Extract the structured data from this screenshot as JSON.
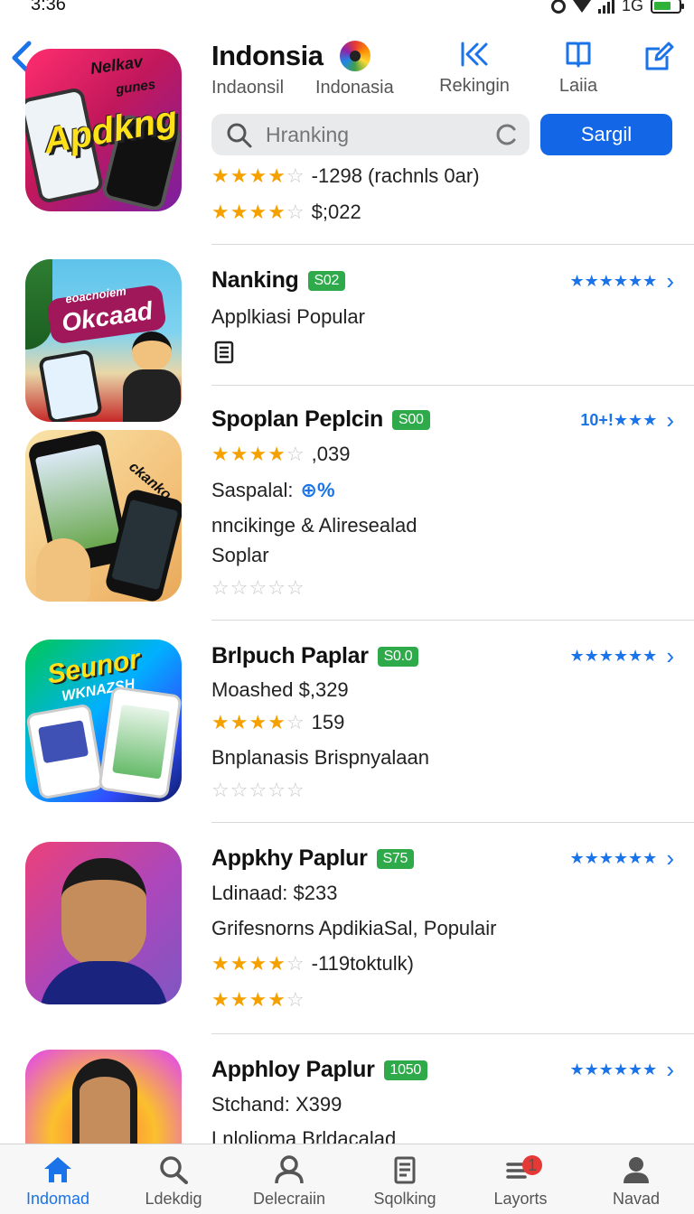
{
  "status_bar": {
    "time": "3:36",
    "network": "1G"
  },
  "header": {
    "title": "Indonsia",
    "subtitle": "Indaonsil",
    "link": "Indonasia",
    "actions": [
      {
        "label": "Rekingin",
        "icon": "rewind-icon"
      },
      {
        "label": "Laiia",
        "icon": "book-icon"
      }
    ],
    "edit_icon": "edit-icon"
  },
  "search": {
    "value": "",
    "placeholder": "Hranking",
    "button_label": "Sargil"
  },
  "featured": {
    "banner_text_top": "Nelkav",
    "banner_text_mid": "gunes",
    "banner_text_main": "Apdkng",
    "rating_line_1": {
      "stars": 4,
      "text": "-1298 (rachnls 0ar)"
    },
    "rating_line_2": {
      "stars": 4,
      "text": "$;022"
    }
  },
  "apps": [
    {
      "name": "Nanking",
      "badge": "S02",
      "rank": "★★★★★★",
      "thumb_text_top": "eoacnoiem",
      "thumb_text_main": "Okcaad",
      "lines": [
        {
          "text": "Applkiasi Popular"
        }
      ],
      "icon": "document-icon"
    },
    {
      "name": "Spoplan Peplcin",
      "badge": "S00",
      "rank": "10+!★★★",
      "thumb_text_main": "ckanko",
      "rating": {
        "stars": 4,
        "text": ",039"
      },
      "lines": [
        {
          "text": "Saspalal:",
          "extra": "⊕%"
        },
        {
          "text": "nncikinge & Aliresealad"
        },
        {
          "text": "Soplar"
        }
      ],
      "empty_rating": 0
    },
    {
      "name": "Brlpuch Paplar",
      "badge": "S0.0",
      "rank": "★★★★★★",
      "thumb_text_main": "Seunor",
      "thumb_text_sub": "WKNAZSH",
      "lines": [
        {
          "text": "Moashed $,329"
        }
      ],
      "rating": {
        "stars": 4,
        "text": "159"
      },
      "extra_line": "Bnplanasis Brispnyalaan",
      "empty_rating": 0
    },
    {
      "name": "Appkhy Paplur",
      "badge": "S75",
      "rank": "★★★★★★",
      "lines": [
        {
          "text": "Ldinaad: $233"
        },
        {
          "text": "Grifesnorns ApdikiaSal, Populair"
        }
      ],
      "rating": {
        "stars": 4,
        "text": "-119toktulk)"
      },
      "rating_2": 4
    },
    {
      "name": "Apphloy Paplur",
      "badge": "1050",
      "rank": "★★★★★★",
      "lines": [
        {
          "text": "Stchand: X399"
        },
        {
          "text": "Lnlolioma Brldacalad"
        }
      ]
    }
  ],
  "nav": [
    {
      "label": "Indomad",
      "icon": "home-icon",
      "active": true
    },
    {
      "label": "Ldekdig",
      "icon": "search-icon"
    },
    {
      "label": "Delecraiin",
      "icon": "person-icon"
    },
    {
      "label": "Sqolking",
      "icon": "clipboard-icon"
    },
    {
      "label": "Layorts",
      "icon": "stack-icon",
      "badge": "1"
    },
    {
      "label": "Navad",
      "icon": "profile-icon"
    }
  ],
  "colors": {
    "accent": "#1367e6",
    "badge_green": "#2eaa4a",
    "star": "#f4a100",
    "notification": "#e53935"
  }
}
